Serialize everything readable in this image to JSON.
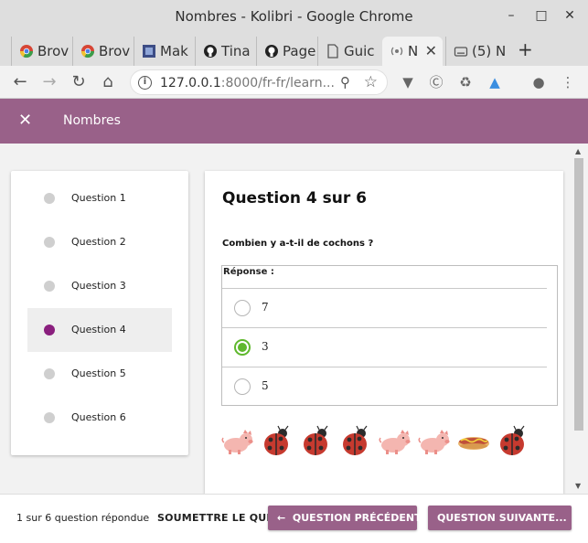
{
  "window": {
    "title": "Nombres - Kolibri - Google Chrome"
  },
  "tabs": [
    {
      "label": "Brov",
      "icon": "chrome-icon"
    },
    {
      "label": "Brov",
      "icon": "chrome-icon"
    },
    {
      "label": "Mak",
      "icon": "blue-square-icon"
    },
    {
      "label": "Tina",
      "icon": "github-icon"
    },
    {
      "label": "Page",
      "icon": "github-icon"
    },
    {
      "label": "Guic",
      "icon": "document-icon"
    },
    {
      "label": "N",
      "icon": "kolibri-icon"
    },
    {
      "label": "(5) N",
      "icon": "keyboard-icon"
    }
  ],
  "address": {
    "host": "127.0.0.1",
    "rest": ":8000/fr-fr/learn..."
  },
  "app": {
    "title": "Nombres"
  },
  "questions": [
    {
      "label": "Question 1"
    },
    {
      "label": "Question 2"
    },
    {
      "label": "Question 3"
    },
    {
      "label": "Question 4"
    },
    {
      "label": "Question 5"
    },
    {
      "label": "Question 6"
    }
  ],
  "current_question": 3,
  "main": {
    "heading": "Question 4 sur 6",
    "question": "Combien y a-t-il de cochons ?",
    "answer_label": "Réponse :",
    "options": [
      "7",
      "3",
      "5"
    ],
    "selected_option": 1,
    "pictures": [
      "pig",
      "ladybug",
      "ladybug",
      "ladybug",
      "pig",
      "pig",
      "hotdog",
      "ladybug"
    ]
  },
  "footer": {
    "progress": "1 sur 6 question répondue",
    "submit": "SOUMETTRE LE QUIZ",
    "prev": "QUESTION PRÉCÉDENTE",
    "next": "QUESTION SUIVANTE..."
  },
  "colors": {
    "brand": "#996189",
    "active_dot": "#8a1f7e",
    "selected_radio": "#5fb82d"
  }
}
